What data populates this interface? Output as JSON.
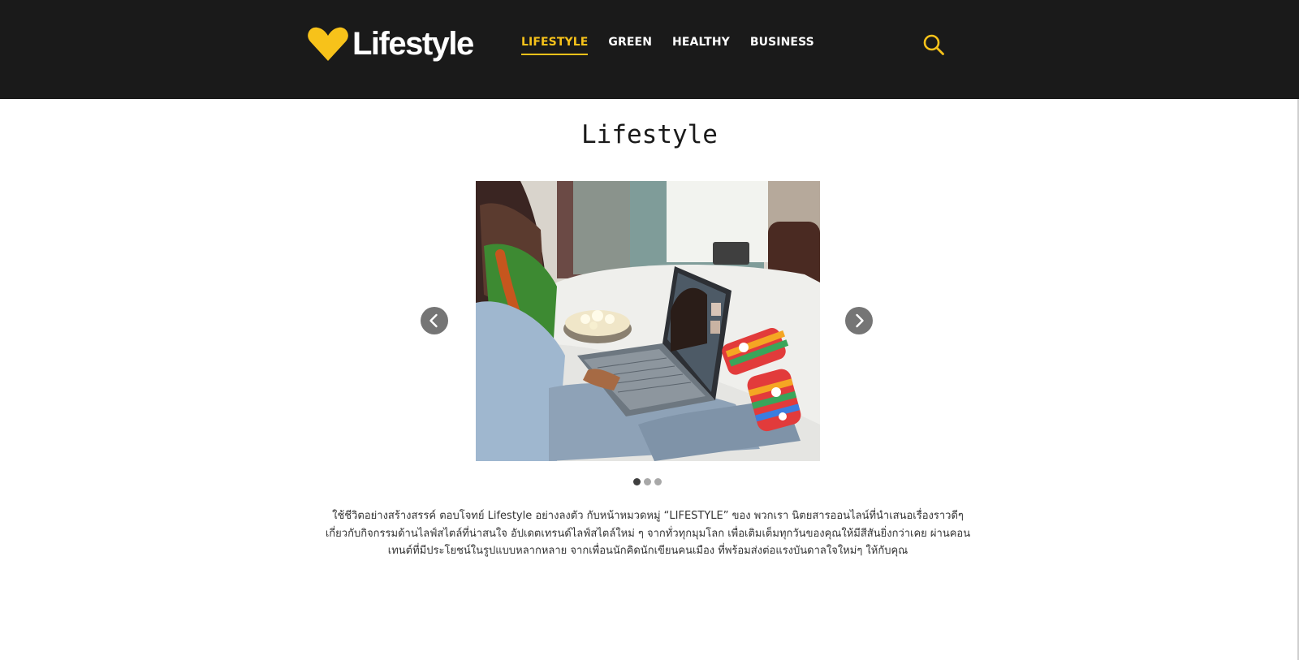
{
  "brand": {
    "name": "Lifestyle",
    "logo_icon": "heart-icon",
    "accent_color": "#f7c21a",
    "header_bg": "#1a1a1a"
  },
  "nav": {
    "items": [
      {
        "label": "LIFESTYLE",
        "active": true
      },
      {
        "label": "GREEN",
        "active": false
      },
      {
        "label": "HEALTHY",
        "active": false
      },
      {
        "label": "BUSINESS",
        "active": false
      }
    ],
    "search_icon": "search-icon"
  },
  "main": {
    "title": "Lifestyle",
    "carousel": {
      "prev_icon": "chevron-left-icon",
      "next_icon": "chevron-right-icon",
      "slide_count": 3,
      "active_slide": 1
    },
    "description": "ใช้ชีวิตอย่างสร้างสรรค์ ตอบโจทย์ Lifestyle อย่างลงตัว กับหน้าหมวดหมู่ “LIFESTYLE” ของ พวกเรา นิตยสารออนไลน์ที่นำเสนอเรื่องราวดีๆ เกี่ยวกับกิจกรรมด้านไลฟ์สไตล์ที่น่าสนใจ อัปเดตเทรนด์ไลฟ์สไตล์ใหม่ ๆ จากทั่วทุกมุมโลก เพื่อเติมเต็มทุกวันของคุณให้มีสีสันยิ่งกว่าเคย ผ่านคอนเทนต์ที่มีประโยชน์ในรูปแบบหลากหลาย จากเพื่อนนักคิดนักเขียนคนเมือง ที่พร้อมส่งต่อแรงบันดาลใจใหม่ๆ ให้กับคุณ"
  }
}
